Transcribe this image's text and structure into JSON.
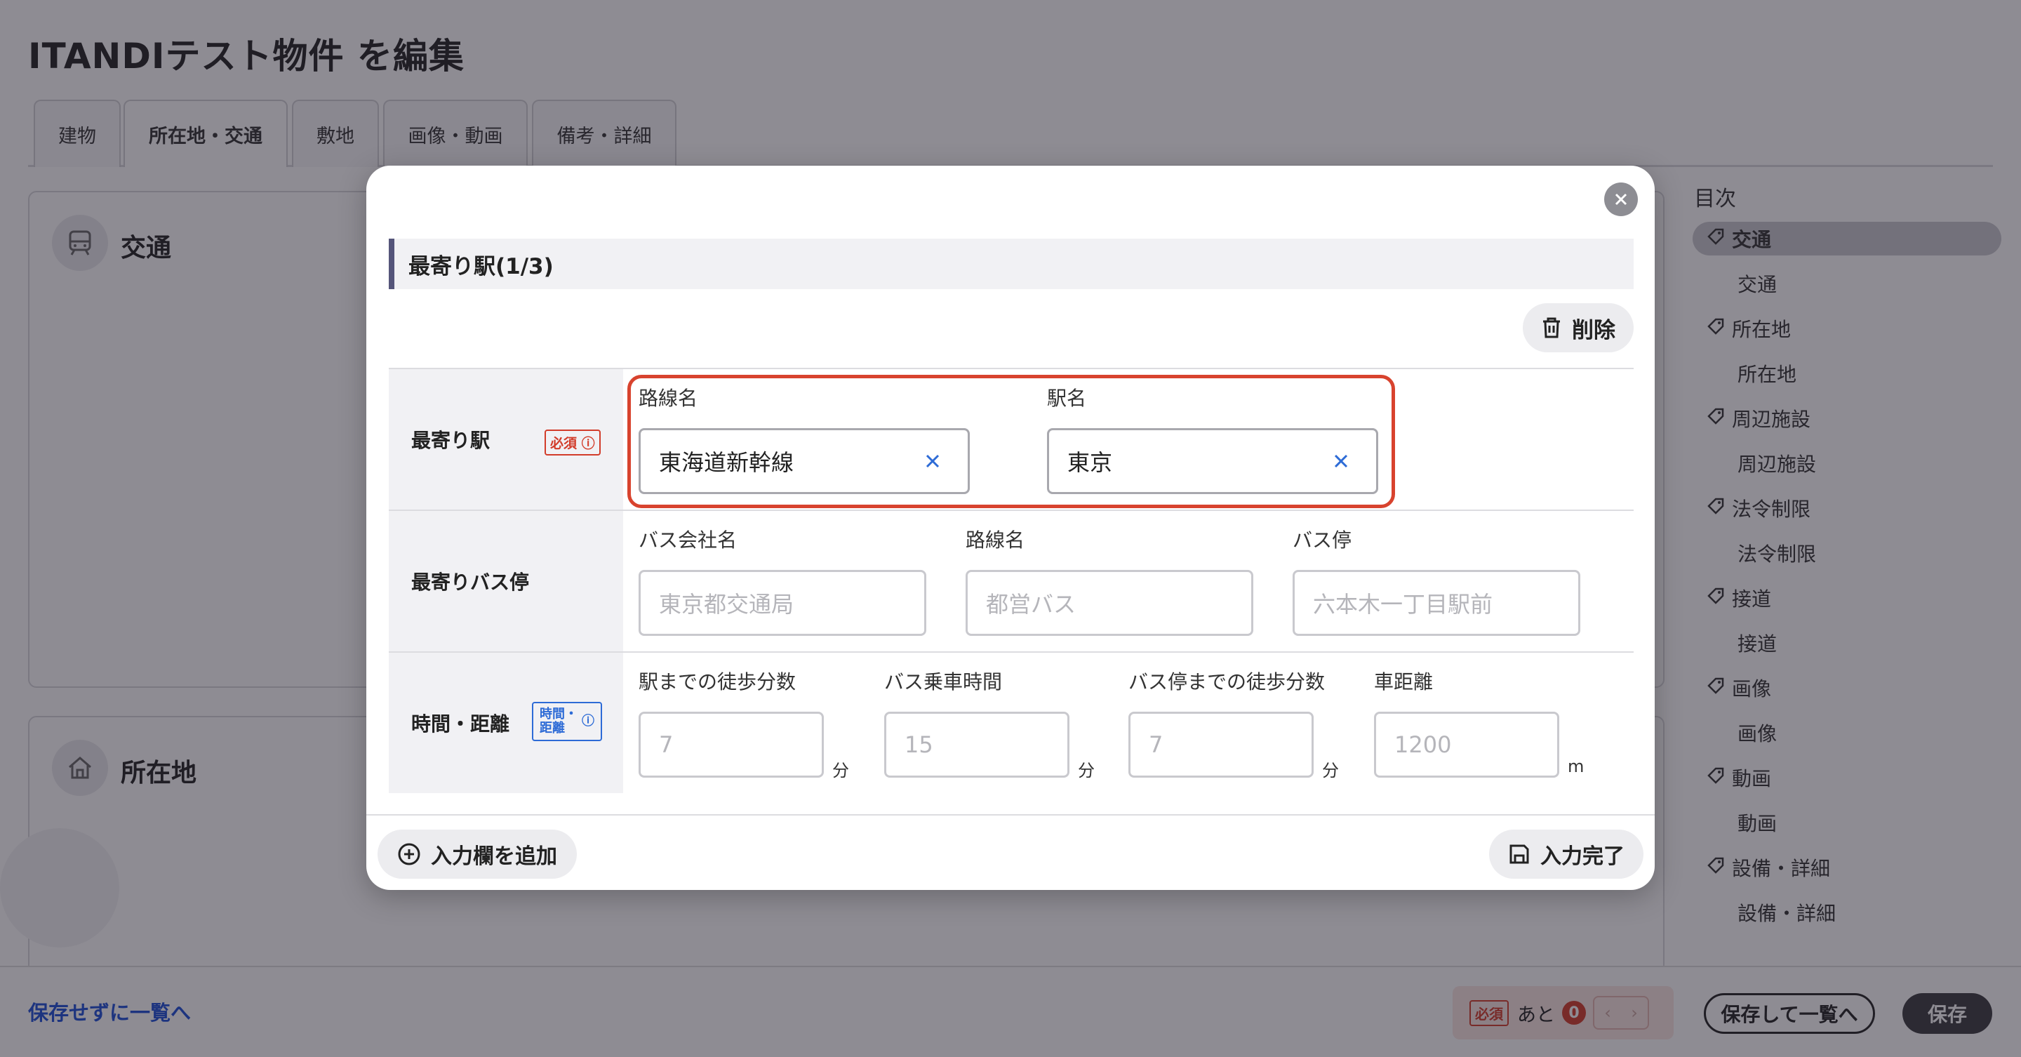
{
  "page": {
    "title": "ITANDIテスト物件 を編集",
    "tabs": [
      {
        "label": "建物"
      },
      {
        "label": "所在地・交通"
      },
      {
        "label": "敷地"
      },
      {
        "label": "画像・動画"
      },
      {
        "label": "備考・詳細"
      }
    ],
    "sections": {
      "transport": "交通",
      "location": "所在地"
    }
  },
  "toc": {
    "heading": "目次",
    "items": [
      {
        "label": "交通",
        "type": "parent",
        "active": true
      },
      {
        "label": "交通",
        "type": "child"
      },
      {
        "label": "所在地",
        "type": "parent"
      },
      {
        "label": "所在地",
        "type": "child"
      },
      {
        "label": "周辺施設",
        "type": "parent"
      },
      {
        "label": "周辺施設",
        "type": "child"
      },
      {
        "label": "法令制限",
        "type": "parent"
      },
      {
        "label": "法令制限",
        "type": "child"
      },
      {
        "label": "接道",
        "type": "parent"
      },
      {
        "label": "接道",
        "type": "child"
      },
      {
        "label": "画像",
        "type": "parent"
      },
      {
        "label": "画像",
        "type": "child"
      },
      {
        "label": "動画",
        "type": "parent"
      },
      {
        "label": "動画",
        "type": "child"
      },
      {
        "label": "設備・詳細",
        "type": "parent"
      },
      {
        "label": "設備・詳細",
        "type": "child"
      }
    ]
  },
  "footer": {
    "back_link": "保存せずに一覧へ",
    "required_badge": "必須",
    "remaining_label": "あと",
    "remaining_count": "0",
    "save_list_label": "保存して一覧へ",
    "save_label": "保存"
  },
  "modal": {
    "header": "最寄り駅(1/3)",
    "delete_label": "削除",
    "rows": {
      "station": {
        "label": "最寄り駅",
        "required": "必須",
        "line_label": "路線名",
        "line_value": "東海道新幹線",
        "station_label": "駅名",
        "station_value": "東京"
      },
      "bus": {
        "label": "最寄りバス停",
        "company_label": "バス会社名",
        "company_placeholder": "東京都交通局",
        "route_label": "路線名",
        "route_placeholder": "都営バス",
        "stop_label": "バス停",
        "stop_placeholder": "六本木一丁目駅前"
      },
      "time": {
        "label": "時間・距離",
        "tag_line1": "時間・",
        "tag_line2": "距離",
        "walk_label": "駅までの徒歩分数",
        "walk_placeholder": "7",
        "walk_unit": "分",
        "bus_ride_label": "バス乗車時間",
        "bus_ride_placeholder": "15",
        "bus_ride_unit": "分",
        "bus_walk_label": "バス停までの徒歩分数",
        "bus_walk_placeholder": "7",
        "bus_walk_unit": "分",
        "car_label": "車距離",
        "car_placeholder": "1200",
        "car_unit": "m"
      }
    },
    "add_label": "入力欄を追加",
    "done_label": "入力完了"
  },
  "colors": {
    "accent_red": "#d8432e",
    "link_blue": "#1d4fd6",
    "clear_blue": "#2d6bd6"
  }
}
